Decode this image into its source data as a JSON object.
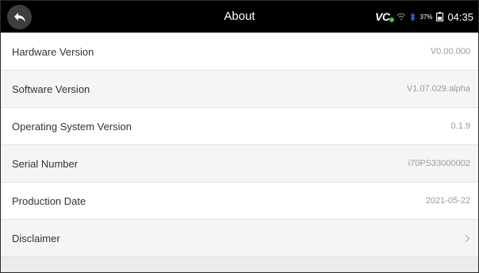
{
  "header": {
    "title": "About",
    "back_icon": "back-arrow-icon",
    "status": {
      "vci_label": "VC",
      "battery_percent": "37%",
      "time": "04:35"
    }
  },
  "rows": [
    {
      "label": "Hardware Version",
      "value": "V0.00.000"
    },
    {
      "label": "Software Version",
      "value": "V1.07.029.alpha"
    },
    {
      "label": "Operating System Version",
      "value": "0.1.9"
    },
    {
      "label": "Serial Number",
      "value": "i70PS33000002"
    },
    {
      "label": "Production Date",
      "value": "2021-05-22"
    },
    {
      "label": "Disclaimer",
      "value": ""
    }
  ],
  "colors": {
    "header_bg": "#000000",
    "vci_status": "#3ec23e",
    "wifi": "#7a7a7a",
    "bluetooth": "#2f7dd8"
  }
}
